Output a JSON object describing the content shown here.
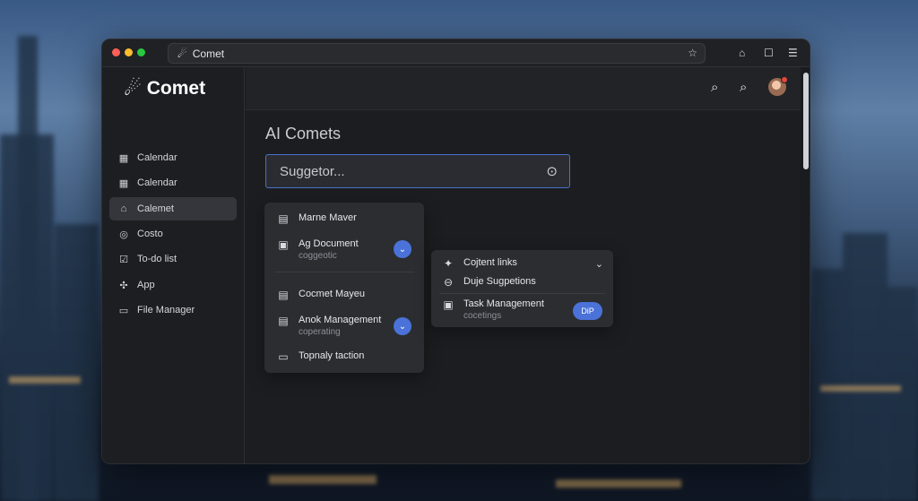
{
  "browser": {
    "address_text": "Comet"
  },
  "sidebar": {
    "brand": "Comet",
    "items": [
      {
        "label": "Calendar",
        "icon": "calendar-icon"
      },
      {
        "label": "Calendar",
        "icon": "calendar-icon"
      },
      {
        "label": "Calemet",
        "icon": "home-icon",
        "active": true
      },
      {
        "label": "Costo",
        "icon": "target-icon"
      },
      {
        "label": "To-do list",
        "icon": "checklist-icon"
      },
      {
        "label": "App",
        "icon": "app-icon"
      },
      {
        "label": "File Manager",
        "icon": "folder-icon"
      }
    ]
  },
  "main": {
    "title": "AI Comets",
    "search": {
      "value": "Suggetor..."
    }
  },
  "panel_left": {
    "items": [
      {
        "title": "Marne Maver",
        "icon": "document-icon"
      },
      {
        "title": "Ag Document",
        "subtitle": "coggeotic",
        "icon": "doc-star-icon"
      },
      {
        "title": "Cocmet Mayeu",
        "icon": "document-icon"
      },
      {
        "title": "Anok Management",
        "subtitle": "coperating",
        "icon": "document-icon"
      },
      {
        "title": "Topnaly taction",
        "icon": "window-icon"
      }
    ]
  },
  "panel_right": {
    "header": "Cojtent links",
    "items": [
      {
        "title": "Duje Sugpetions",
        "icon": "link-icon"
      },
      {
        "title": "Task Management",
        "subtitle": "cocetings",
        "icon": "task-icon"
      }
    ],
    "pill_label": "DiP"
  },
  "colors": {
    "accent": "#4a72d8",
    "window_bg": "#1c1d20",
    "panel_bg": "#2b2d31"
  }
}
